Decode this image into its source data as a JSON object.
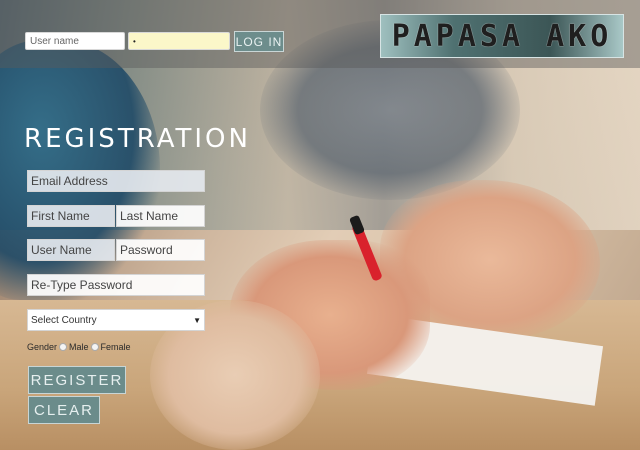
{
  "header": {
    "username_placeholder": "User name",
    "password_masked": "•",
    "login_label": "LOG IN",
    "brand": "PAPASA AKO"
  },
  "registration": {
    "title": "REGISTRATION",
    "email": "Email Address",
    "first_name": "First Name",
    "last_name": "Last Name",
    "user_name": "User Name",
    "password": "Password",
    "retype_password": "Re-Type Password",
    "country_select": "Select Country",
    "gender_label": "Gender",
    "male_label": "Male",
    "female_label": "Female",
    "register_label": "REGISTER",
    "clear_label": "CLEAR"
  },
  "colors": {
    "button_bg": "#6b8c8b",
    "password_field_bg": "#fbf7c9"
  }
}
